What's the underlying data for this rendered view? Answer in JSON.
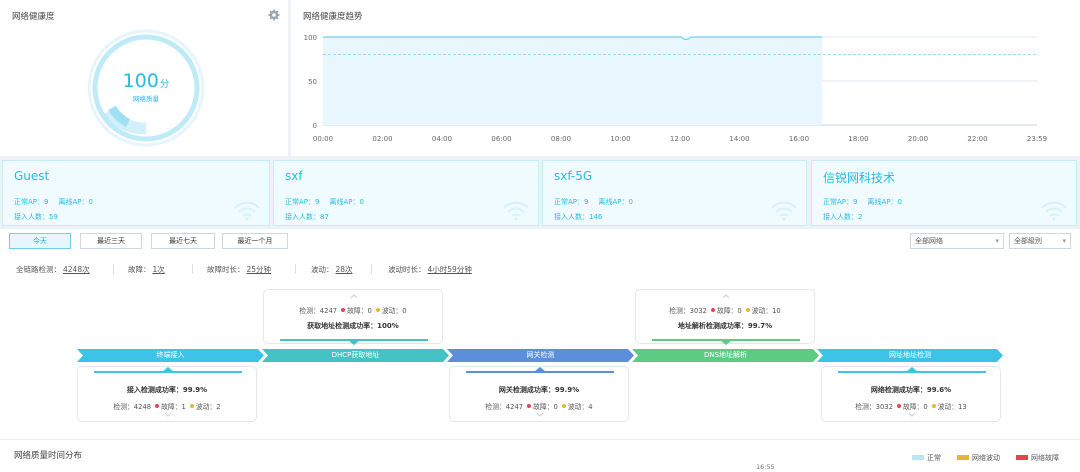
{
  "health": {
    "title": "网络健康度",
    "score": "100",
    "unit": "分",
    "label": "网络质量"
  },
  "trend": {
    "title": "网络健康度趋势",
    "y_ticks": [
      "100",
      "50",
      "0"
    ],
    "x_ticks": [
      "00:00",
      "02:00",
      "04:00",
      "06:00",
      "08:00",
      "10:00",
      "12:00",
      "14:00",
      "16:00",
      "18:00",
      "20:00",
      "22:00",
      "23:59"
    ]
  },
  "ssids": [
    {
      "name": "Guest",
      "normal_ap": "正常AP：9",
      "offline_ap": "离线AP：0",
      "users": "接入人数：59"
    },
    {
      "name": "sxf",
      "normal_ap": "正常AP：9",
      "offline_ap": "离线AP：0",
      "users": "接入人数：87"
    },
    {
      "name": "sxf-5G",
      "normal_ap": "正常AP：9",
      "offline_ap": "离线AP：0",
      "users": "接入人数：146"
    },
    {
      "name": "信锐网科技术",
      "normal_ap": "正常AP：9",
      "offline_ap": "离线AP：0",
      "users": "接入人数：2"
    }
  ],
  "ranges": [
    "今天",
    "最近三天",
    "最近七天",
    "最近一个月"
  ],
  "filters": {
    "network": "全部网络",
    "level": "全部級別"
  },
  "stats": [
    {
      "label": "全链路检测：",
      "value": "4248次"
    },
    {
      "label": "故障：",
      "value": "1次"
    },
    {
      "label": "故障时长：",
      "value": "25分钟"
    },
    {
      "label": "波动：",
      "value": "28次"
    },
    {
      "label": "波动时长：",
      "value": "4小时59分钟"
    }
  ],
  "steps": [
    {
      "label": "终端接入",
      "color": "#3ec3e8",
      "rate": "接入检测成功率：99.9%",
      "detect": "检测：4248",
      "fault": "故障：1",
      "wave": "波动：2"
    },
    {
      "label": "DHCP获取地址",
      "color": "#45c3c4",
      "rate": "获取地址检测成功率：100%",
      "detect": "检测：4247",
      "fault": "故障：0",
      "wave": "波动：0"
    },
    {
      "label": "网关检测",
      "color": "#5b8fdc",
      "rate": "网关检测成功率：99.9%",
      "detect": "检测：4247",
      "fault": "故障：0",
      "wave": "波动：4"
    },
    {
      "label": "DNS地址解析",
      "color": "#5ccb84",
      "rate": "地址解析检测成功率：99.7%",
      "detect": "检测：3032",
      "fault": "故障：0",
      "wave": "波动：10"
    },
    {
      "label": "网址地址检测",
      "color": "#3ec3e8",
      "rate": "网络检测成功率：99.6%",
      "detect": "检测：3032",
      "fault": "故障：0",
      "wave": "波动：13"
    }
  ],
  "bottom": {
    "title": "网络质量时间分布",
    "time": "16:55",
    "legend": [
      {
        "label": "正常",
        "color": "#b9e6f7"
      },
      {
        "label": "网络波动",
        "color": "#e9b33a"
      },
      {
        "label": "网络故障",
        "color": "#e0474c"
      }
    ]
  },
  "colors": {
    "accent": "#29b9e4",
    "fault": "#e0474c",
    "wave": "#e9b33a"
  }
}
